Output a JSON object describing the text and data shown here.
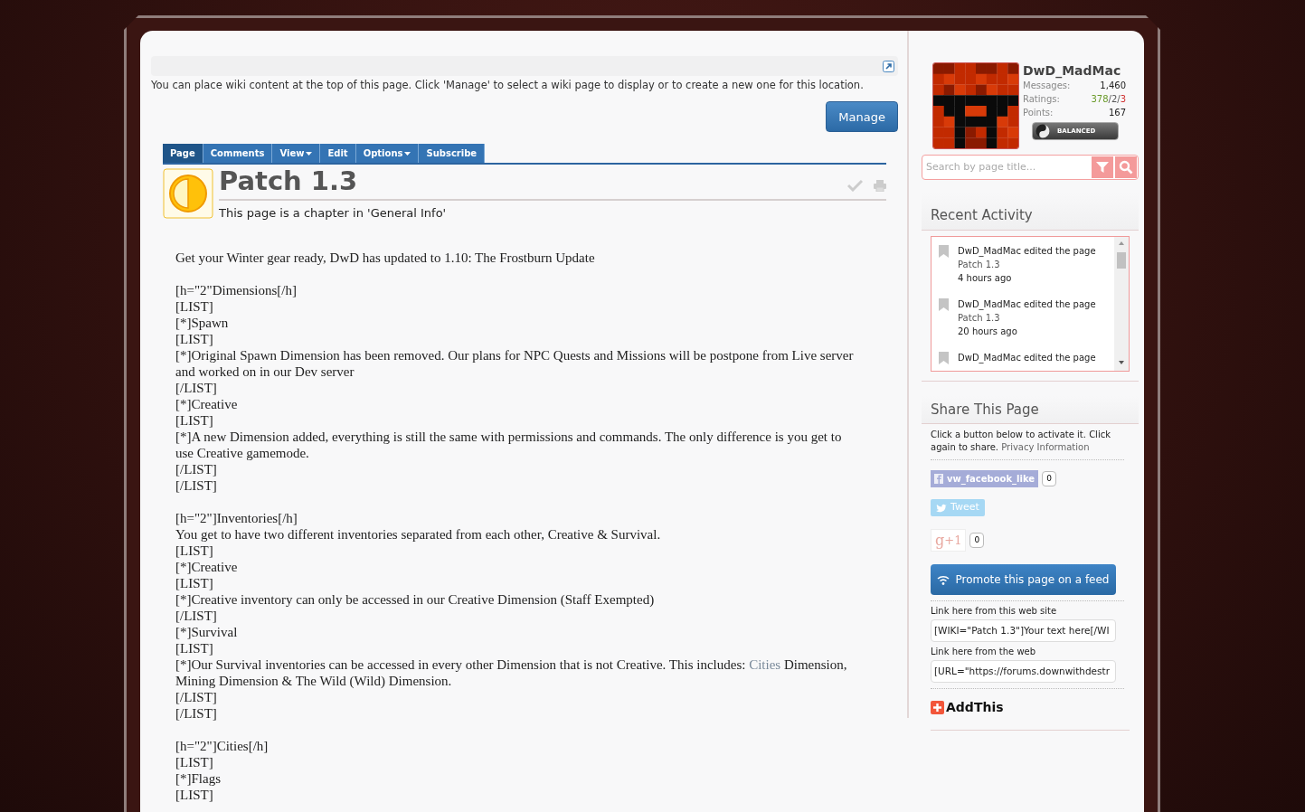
{
  "wiki_notice": {
    "text": "You can place wiki content at the top of this page. Click 'Manage' to select a wiki page to display or to create a new one for this location.",
    "button": "Manage"
  },
  "tabs": [
    {
      "label": "Page",
      "selected": true,
      "dropdown": false
    },
    {
      "label": "Comments",
      "selected": false,
      "dropdown": false
    },
    {
      "label": "View",
      "selected": false,
      "dropdown": true
    },
    {
      "label": "Edit",
      "selected": false,
      "dropdown": false
    },
    {
      "label": "Options",
      "selected": false,
      "dropdown": true
    },
    {
      "label": "Subscribe",
      "selected": false,
      "dropdown": false
    }
  ],
  "page": {
    "title": "Patch 1.3",
    "subtitle": "This page is a chapter in 'General Info'"
  },
  "body": [
    [
      "Get your Winter gear ready, DwD has updated to 1.10: The Frostburn Update"
    ],
    [
      "[h=\"2\"Dimensions[/h]",
      "[LIST]",
      "[*]Spawn",
      "[LIST]",
      "[*]Original Spawn Dimension has been removed. Our plans for NPC Quests and Missions will be postpone from Live server and worked on in our Dev server",
      "[/LIST]",
      "[*]Creative",
      "[LIST]",
      "[*]A new Dimension added, everything is still the same with permissions and commands. The only difference is you get to use Creative gamemode.",
      "[/LIST]",
      "[/LIST]"
    ],
    [
      "[h=\"2\"]Inventories[/h]",
      "You get to have two different inventories separated from each other, Creative & Survival.",
      "[LIST]",
      "[*]Creative",
      "[LIST]",
      "[*]Creative inventory can only be accessed in our Creative Dimension (Staff Exempted)",
      "[/LIST]",
      "[*]Survival",
      "[LIST]",
      {
        "before": "[*]Our Survival inventories can be accessed in every other Dimension that is not Creative. This includes: ",
        "link": "Cities",
        "after": " Dimension, Mining Dimension & The Wild (Wild) Dimension."
      },
      "[/LIST]",
      "[/LIST]"
    ],
    [
      "[h=\"2\"]Cities[/h]",
      "[LIST]",
      "[*]Flags",
      "[LIST]"
    ]
  ],
  "user": {
    "name": "DwD_MadMac",
    "stats": [
      {
        "label": "Messages:",
        "parts": [
          {
            "text": "1,460",
            "color": "#222222"
          }
        ]
      },
      {
        "label": "Ratings:",
        "parts": [
          {
            "text": "378",
            "color": "#6a9a2a"
          },
          {
            "text": "/2/",
            "color": "#555555"
          },
          {
            "text": "3",
            "color": "#d03030"
          }
        ]
      },
      {
        "label": "Points:",
        "parts": [
          {
            "text": "167",
            "color": "#222222"
          }
        ]
      }
    ],
    "badge": "BALANCED"
  },
  "search": {
    "placeholder": "Search by page title..."
  },
  "recent_activity": {
    "title": "Recent Activity",
    "items": [
      {
        "action": "DwD_MadMac edited the page",
        "page": "Patch 1.3",
        "time": "4 hours ago"
      },
      {
        "action": "DwD_MadMac edited the page",
        "page": "Patch 1.3",
        "time": "20 hours ago"
      },
      {
        "action": "DwD_MadMac edited the page"
      }
    ]
  },
  "share": {
    "title": "Share This Page",
    "text": "Click a button below to activate it. Click again to share.",
    "privacy_link": "Privacy Information",
    "facebook": {
      "label": "vw_facebook_like",
      "count": "0"
    },
    "tweet": "Tweet",
    "gplus": {
      "glyph": "g",
      "label": "+1",
      "count": "0"
    },
    "promote": "Promote this page on a feed",
    "links": [
      {
        "label": "Link here from this web site",
        "value": "[WIKI=\"Patch 1.3\"]Your text here[/WI"
      },
      {
        "label": "Link here from the web",
        "value": "[URL=\"https://forums.downwithdestr"
      }
    ],
    "addthis": "AddThis"
  }
}
